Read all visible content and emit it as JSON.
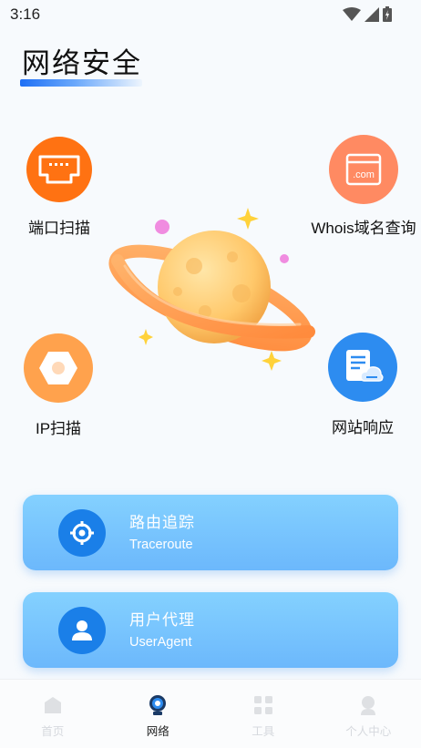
{
  "status_bar": {
    "time": "3:16"
  },
  "header": {
    "title": "网络安全"
  },
  "features": {
    "port_scan": {
      "label": "端口扫描",
      "icon": "ethernet-port-icon",
      "color": "#ff7212"
    },
    "whois": {
      "label": "Whois域名查询",
      "icon": "dotcom-icon",
      "icon_text": ".com",
      "color": "#ff8a62"
    },
    "ip_scan": {
      "label": "IP扫描",
      "icon": "hexagon-icon",
      "color": "#ffa24d"
    },
    "website": {
      "label": "网站响应",
      "icon": "document-cloud-icon",
      "color": "#2d8cf0"
    }
  },
  "cards": {
    "traceroute": {
      "title": "路由追踪",
      "subtitle": "Traceroute",
      "icon": "target-icon"
    },
    "useragent": {
      "title": "用户代理",
      "subtitle": "UserAgent",
      "icon": "user-icon"
    }
  },
  "bottom_nav": {
    "items": [
      {
        "label": "首页",
        "icon": "home-icon",
        "active": false
      },
      {
        "label": "网络",
        "icon": "network-icon",
        "active": true
      },
      {
        "label": "工具",
        "icon": "grid-icon",
        "active": false
      },
      {
        "label": "个人中心",
        "icon": "profile-icon",
        "active": false
      }
    ]
  }
}
